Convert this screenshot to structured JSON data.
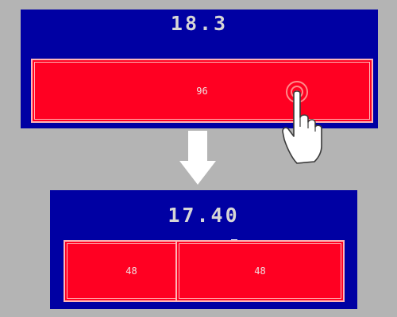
{
  "before": {
    "score": "18.3",
    "cell": {
      "value": "96"
    }
  },
  "after": {
    "score": "17.40",
    "cells": [
      {
        "value": "48"
      },
      {
        "value": "48"
      }
    ]
  },
  "colors": {
    "background": "#b4b4b4",
    "panel": "#0000a3",
    "cell": "#ff0022",
    "score_text": "#d6d6d6"
  },
  "icons": {
    "transition": "arrow-down-icon",
    "gesture": "tap-hand-icon"
  }
}
